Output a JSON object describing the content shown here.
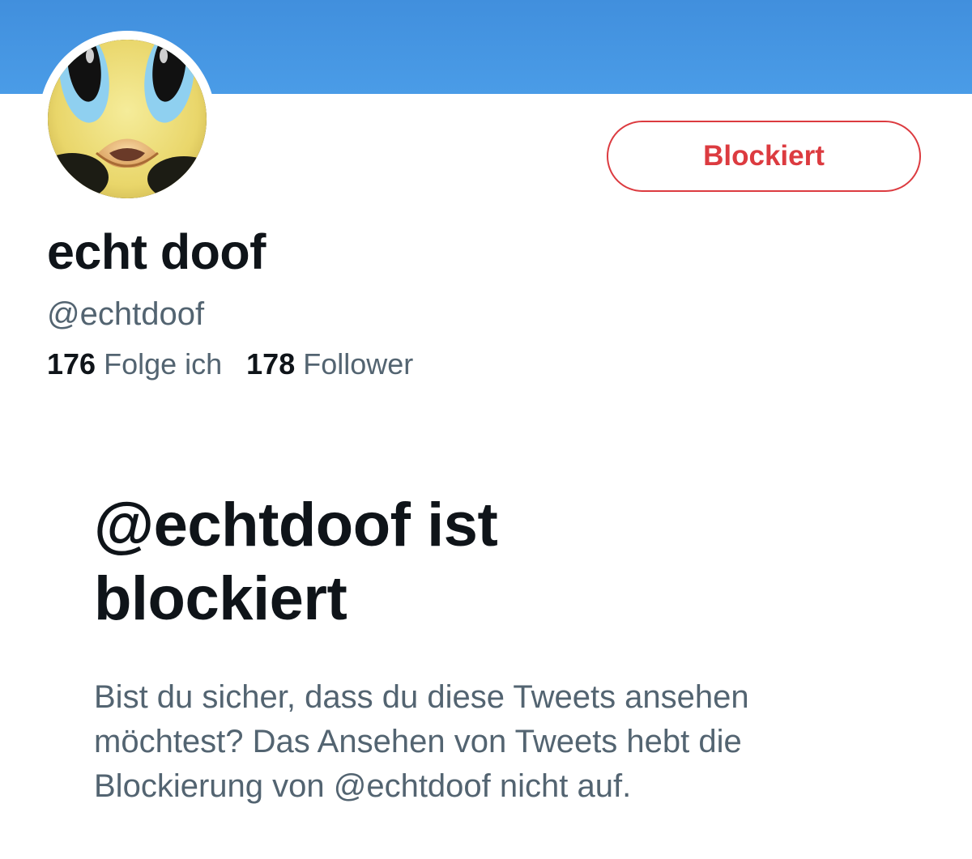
{
  "profile": {
    "display_name": "echt doof",
    "handle": "@echtdoof",
    "avatar_icon": "yellow-cartoon-bird-avatar",
    "block_button_label": "Blockiert",
    "following_count": "176",
    "following_label": "Folge ich",
    "followers_count": "178",
    "followers_label": "Follower"
  },
  "blocked_notice": {
    "title_line1": "@echtdoof ist",
    "title_line2": "blockiert",
    "description": "Bist du sicher, dass du diese Tweets ansehen möchtest? Das Ansehen von Tweets hebt die Blockierung von @echtdoof nicht auf."
  },
  "colors": {
    "banner": "#4a9ce7",
    "block_red": "#dc3b40",
    "text_primary": "#0f1419",
    "text_secondary": "#536471"
  }
}
